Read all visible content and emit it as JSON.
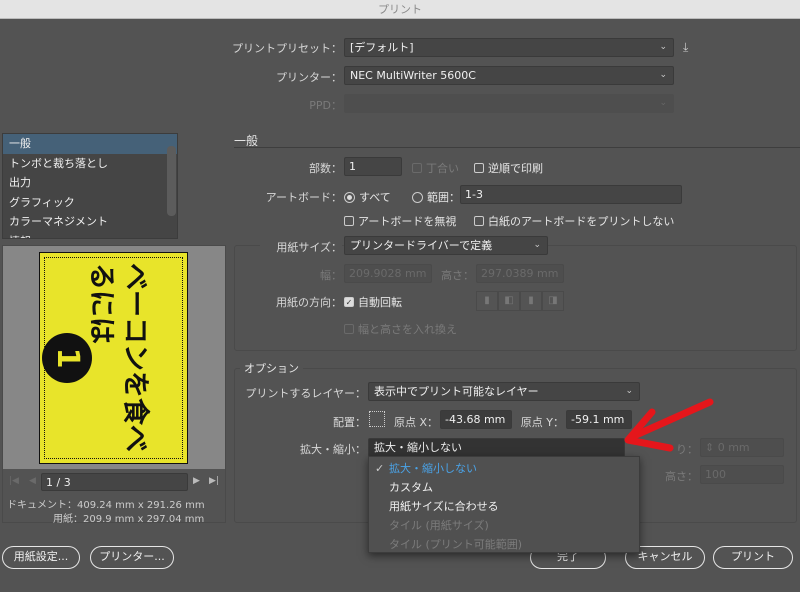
{
  "window": {
    "title": "プリント"
  },
  "preset": {
    "label": "プリントプリセット：",
    "value": "[デフォルト]"
  },
  "printer": {
    "label": "プリンター：",
    "value": "NEC MultiWriter 5600C"
  },
  "ppd": {
    "label": "PPD：",
    "value": ""
  },
  "sidebar": {
    "items": [
      {
        "label": "一般"
      },
      {
        "label": "トンボと裁ち落とし"
      },
      {
        "label": "出力"
      },
      {
        "label": "グラフィック"
      },
      {
        "label": "カラーマネジメント"
      },
      {
        "label": "情報"
      }
    ]
  },
  "general": {
    "title": "一般",
    "copies_label": "部数：",
    "copies": "1",
    "collate": "丁合い",
    "reverse": "逆順で印刷",
    "artboard_label": "アートボード：",
    "all": "すべて",
    "range": "範囲：",
    "range_value": "1-3",
    "ignore_artboards": "アートボードを無視",
    "skip_blank": "白紙のアートボードをプリントしない"
  },
  "paper": {
    "size_label": "用紙サイズ：",
    "size": "プリンタードライバーで定義",
    "width_label": "幅：",
    "width": "209.9028 mm",
    "height_label": "高さ：",
    "height": "297.0389 mm",
    "orientation_label": "用紙の方向：",
    "auto_rotate": "自動回転",
    "transverse": "幅と高さを入れ換え"
  },
  "options": {
    "title": "オプション",
    "layers_label": "プリントするレイヤー：",
    "layers": "表示中でプリント可能なレイヤー",
    "placement_label": "配置：",
    "origin_x_label": "原点 X：",
    "origin_x": "-43.68 mm",
    "origin_y_label": "原点 Y：",
    "origin_y": "-59.1 mm",
    "scale_label": "拡大・縮小：",
    "scale": "拡大・縮小しない",
    "overlap_label": "り：",
    "overlap": "0 mm",
    "scale_h_label": "高さ：",
    "scale_h": "100"
  },
  "scale_menu": [
    {
      "label": "拡大・縮小しない",
      "state": "selected"
    },
    {
      "label": "カスタム",
      "state": "enabled"
    },
    {
      "label": "用紙サイズに合わせる",
      "state": "enabled"
    },
    {
      "label": "タイル (用紙サイズ)",
      "state": "disabled"
    },
    {
      "label": "タイル (プリント可能範囲)",
      "state": "disabled"
    }
  ],
  "preview": {
    "artwork_text": "ベーコンを食べるには",
    "badge": "1",
    "page": "1 / 3",
    "document": "ドキュメント：409.24 mm x 291.26 mm",
    "paper": "用紙：209.9 mm x 297.04 mm",
    "page_color": "#e8e42a"
  },
  "buttons": {
    "page_setup": "用紙設定...",
    "printer": "プリンター...",
    "done": "完了",
    "cancel": "キャンセル",
    "print": "プリント"
  },
  "annotation": {
    "color": "#e5161b"
  }
}
